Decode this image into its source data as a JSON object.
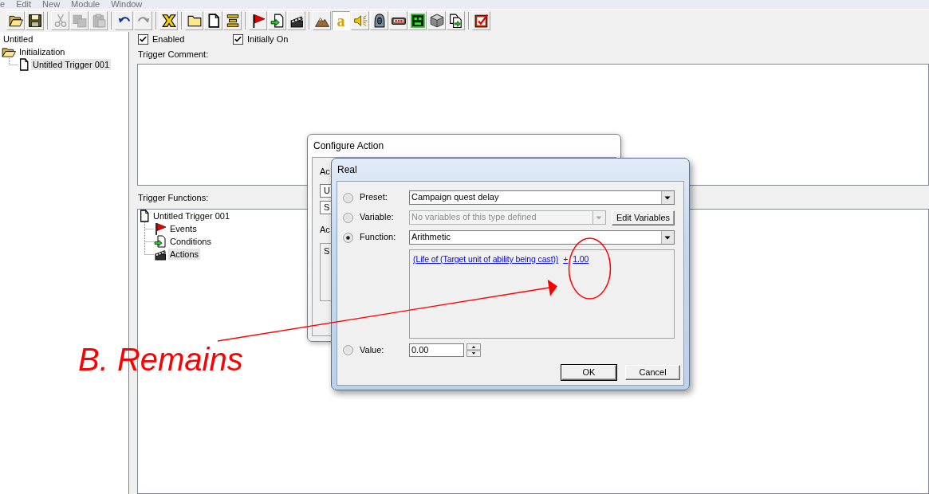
{
  "menu_bar": [
    {
      "label": "e"
    },
    {
      "label": "Edit"
    },
    {
      "label": "New"
    },
    {
      "label": "Module"
    },
    {
      "label": "Window"
    }
  ],
  "toolbar": [
    [
      {
        "disabled": false,
        "pressed": false
      },
      {
        "disabled": false,
        "pressed": false
      }
    ],
    [
      {
        "disabled": true,
        "pressed": false
      },
      {
        "disabled": true,
        "pressed": false
      },
      {
        "disabled": true,
        "pressed": false
      }
    ],
    [
      {
        "disabled": false,
        "pressed": false
      },
      {
        "disabled": true,
        "pressed": false
      }
    ],
    [
      {
        "disabled": false,
        "pressed": false
      }
    ],
    [
      {
        "disabled": false,
        "pressed": false
      },
      {
        "disabled": false,
        "pressed": false
      },
      {
        "disabled": false,
        "pressed": false
      }
    ],
    [
      {
        "disabled": false,
        "pressed": false
      },
      {
        "disabled": false,
        "pressed": false
      },
      {
        "disabled": false,
        "pressed": false
      }
    ],
    [
      {
        "disabled": false,
        "pressed": false
      },
      {
        "label": "a",
        "disabled": false,
        "pressed": true
      },
      {
        "disabled": false,
        "pressed": false
      },
      {
        "disabled": false,
        "pressed": false
      },
      {
        "disabled": false,
        "pressed": false
      },
      {
        "disabled": false,
        "pressed": false
      },
      {
        "disabled": false,
        "pressed": false
      },
      {
        "disabled": false,
        "pressed": false
      }
    ],
    [
      {
        "disabled": false,
        "pressed": false
      }
    ]
  ],
  "trigger_list": [
    {
      "label": "Untitled",
      "kind": "map",
      "selected": false
    },
    {
      "label": "Initialization",
      "kind": "category",
      "selected": false,
      "expanded": true,
      "children": [
        {
          "label": "Untitled Trigger 001",
          "kind": "trigger",
          "selected": true
        }
      ]
    }
  ],
  "trigger_options": [
    {
      "label": "Enabled",
      "checked": true
    },
    {
      "label": "Initially On",
      "checked": true
    }
  ],
  "comment_label": "Trigger Comment:",
  "functions_label": "Trigger Functions:",
  "functions_tree": [
    {
      "label": "Untitled Trigger 001",
      "kind": "trigger",
      "selected": false,
      "children": [
        {
          "label": "Events",
          "kind": "events",
          "selected": false
        },
        {
          "label": "Conditions",
          "kind": "conditions",
          "selected": false
        },
        {
          "label": "Actions",
          "kind": "actions",
          "selected": true
        }
      ]
    }
  ],
  "configure_action": {
    "title": "Configure Action",
    "items": [
      {
        "kind": "label",
        "text": "Ac"
      },
      {
        "kind": "field",
        "text": "U"
      },
      {
        "kind": "field",
        "text": "S"
      },
      {
        "kind": "label",
        "text": "Ac"
      },
      {
        "kind": "list",
        "text": "S"
      }
    ]
  },
  "real_dialog": {
    "title": "Real",
    "rows": [
      {
        "kind": "select",
        "label": "Preset:",
        "selected": false,
        "value": "Campaign quest delay",
        "disabled": false
      },
      {
        "kind": "select",
        "label": "Variable:",
        "selected": false,
        "value": "No variables of this type defined",
        "disabled": true,
        "button": "Edit Variables"
      },
      {
        "kind": "select",
        "label": "Function:",
        "selected": true,
        "value": "Arithmetic",
        "disabled": false,
        "expression": [
          "(Life of (Target unit of ability being cast))",
          "+",
          "1.00"
        ]
      },
      {
        "kind": "spin",
        "label": "Value:",
        "selected": false,
        "value": "0.00"
      }
    ],
    "buttons": [
      {
        "label": "OK",
        "default": true
      },
      {
        "label": "Cancel",
        "default": false
      }
    ]
  },
  "annotation": {
    "text": "B. Remains"
  }
}
